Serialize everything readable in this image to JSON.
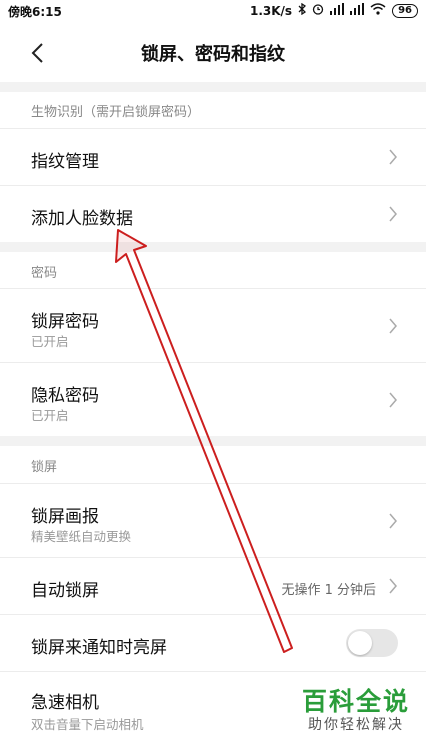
{
  "status_bar": {
    "time": "傍晚6:15",
    "speed": "1.3K/s",
    "battery": "96",
    "icons": [
      "bluetooth-icon",
      "alarm-icon",
      "signal-icon",
      "signal-icon",
      "wifi-icon"
    ]
  },
  "header": {
    "title": "锁屏、密码和指纹",
    "back_icon": "chevron-left-icon"
  },
  "sections": {
    "biometric": {
      "label": "生物识别（需开启锁屏密码）",
      "items": [
        {
          "title": "指纹管理"
        },
        {
          "title": "添加人脸数据"
        }
      ]
    },
    "password": {
      "label": "密码",
      "items": [
        {
          "title": "锁屏密码",
          "subtitle": "已开启"
        },
        {
          "title": "隐私密码",
          "subtitle": "已开启"
        }
      ]
    },
    "lockscreen": {
      "label": "锁屏",
      "items": [
        {
          "title": "锁屏画报",
          "subtitle": "精美壁纸自动更换"
        },
        {
          "title": "自动锁屏",
          "value": "无操作 1 分钟后"
        },
        {
          "title": "锁屏来通知时亮屏",
          "toggle_on": false
        },
        {
          "title": "急速相机",
          "subtitle": "双击音量下启动相机"
        }
      ]
    }
  },
  "watermark": {
    "title": "百科全说",
    "subtitle": "助你轻松解决"
  },
  "colors": {
    "annotation_arrow": "#cc1f1f",
    "watermark_green": "#2a9d3a"
  }
}
